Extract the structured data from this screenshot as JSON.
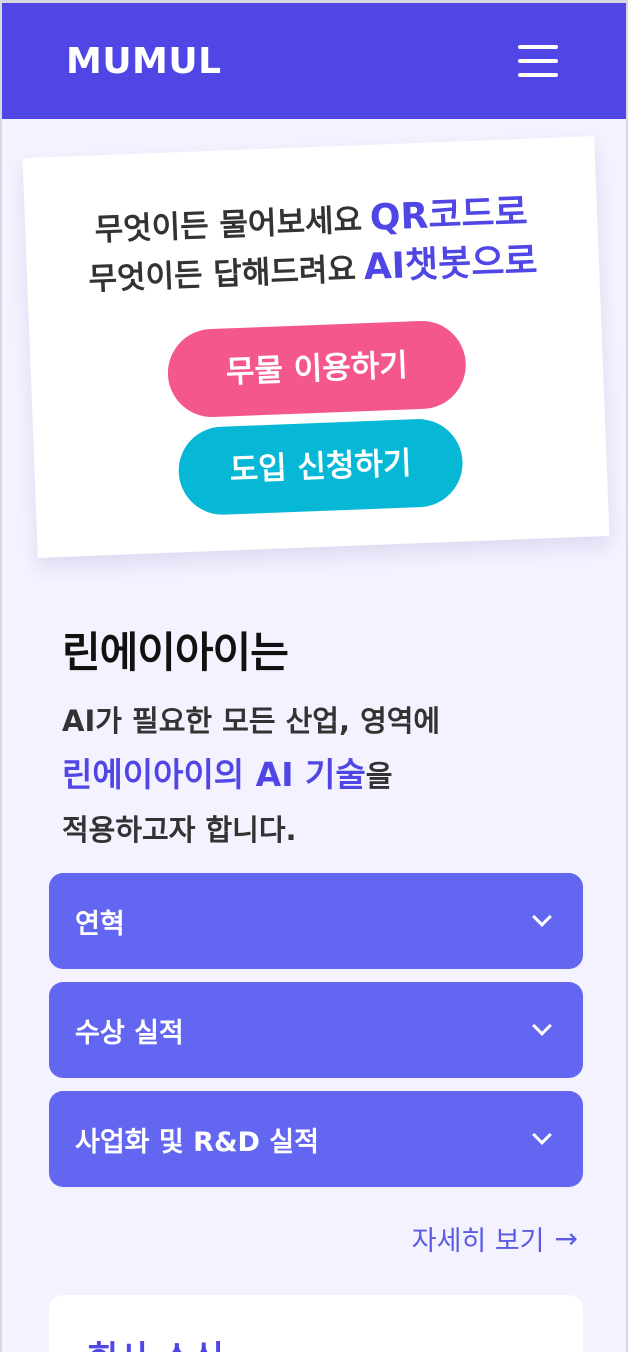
{
  "header": {
    "logo": "MUMUL",
    "menu_icon": "hamburger-menu-icon"
  },
  "hero": {
    "line1_text": "무엇이든 물어보세요",
    "line1_accent": "QR코드로",
    "line2_text": "무엇이든 답해드려요",
    "line2_accent": "AI챗봇으로",
    "free_button": "무물 이용하기",
    "apply_button": "도입 신청하기"
  },
  "about": {
    "title": "린에이아이는",
    "desc_line1": "AI가 필요한 모든 산업, 영역에",
    "desc_accent": "린에이아이의 AI 기술",
    "desc_suffix": "을",
    "desc_line3": "적용하고자 합니다."
  },
  "accordion": [
    {
      "label": "연혁"
    },
    {
      "label": "수상 실적"
    },
    {
      "label": "사업화 및 R&D 실적"
    }
  ],
  "more_link": "자세히 보기",
  "news": {
    "title": "회사 소식"
  },
  "colors": {
    "primary": "#4f46e5",
    "accordion": "#6366f1",
    "pink": "#f4568e",
    "cyan": "#06b8d6",
    "background": "#f3f2fe"
  }
}
